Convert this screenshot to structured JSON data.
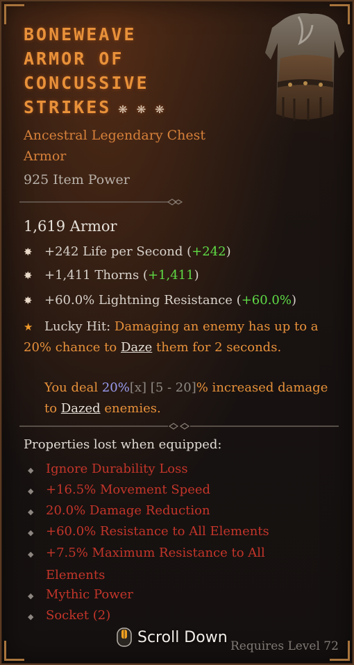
{
  "item": {
    "title_lines": [
      "BONEWEAVE",
      "ARMOR OF",
      "CONCUSSIVE",
      "STRIKES"
    ],
    "greater_affix_stars": "❋ ❋ ❋",
    "type_line1": "Ancestral Legendary Chest",
    "type_line2": "Armor",
    "item_power": "925 Item Power",
    "armor": "1,619 Armor"
  },
  "affixes": [
    {
      "text": "+242 Life per Second (",
      "gain": "+242",
      "close": ")"
    },
    {
      "text": "+1,411 Thorns (",
      "gain": "+1,411",
      "close": ")"
    },
    {
      "text": "+60.0% Lightning Resistance (",
      "gain": "+60.0%",
      "close": ")"
    }
  ],
  "lucky_hit": {
    "label": "Lucky Hit: ",
    "part1": "Damaging an enemy has up to a 20% chance to ",
    "keyword": "Daze",
    "part2": " them for 2 seconds."
  },
  "unique_power": {
    "prefix": "You deal ",
    "value": "20%",
    "bracket_x": "[x]",
    "range": " [5 - 20]",
    "suffix1": "% increased damage to ",
    "keyword": "Dazed",
    "suffix2": " enemies."
  },
  "lost": {
    "heading": "Properties lost when equipped:",
    "items": [
      "Ignore Durability Loss",
      "+16.5% Movement Speed",
      "20.0% Damage Reduction",
      "+60.0% Resistance to All Elements",
      "+7.5% Maximum Resistance to All",
      "Mythic Power",
      "Socket (2)"
    ],
    "item5_cont": "Elements"
  },
  "requirement": "Requires Level 72",
  "scroll_label": "Scroll Down",
  "colors": {
    "legendary": "#e8913a",
    "gain": "#5fdc46",
    "lost": "#c4352a",
    "scaling": "#9a9cf0"
  },
  "icons": {
    "affix_bullet": "burst-icon",
    "lucky_bullet": "star-icon",
    "lost_bullet": "diamond-icon",
    "scroll": "mouse-scroll-icon"
  }
}
